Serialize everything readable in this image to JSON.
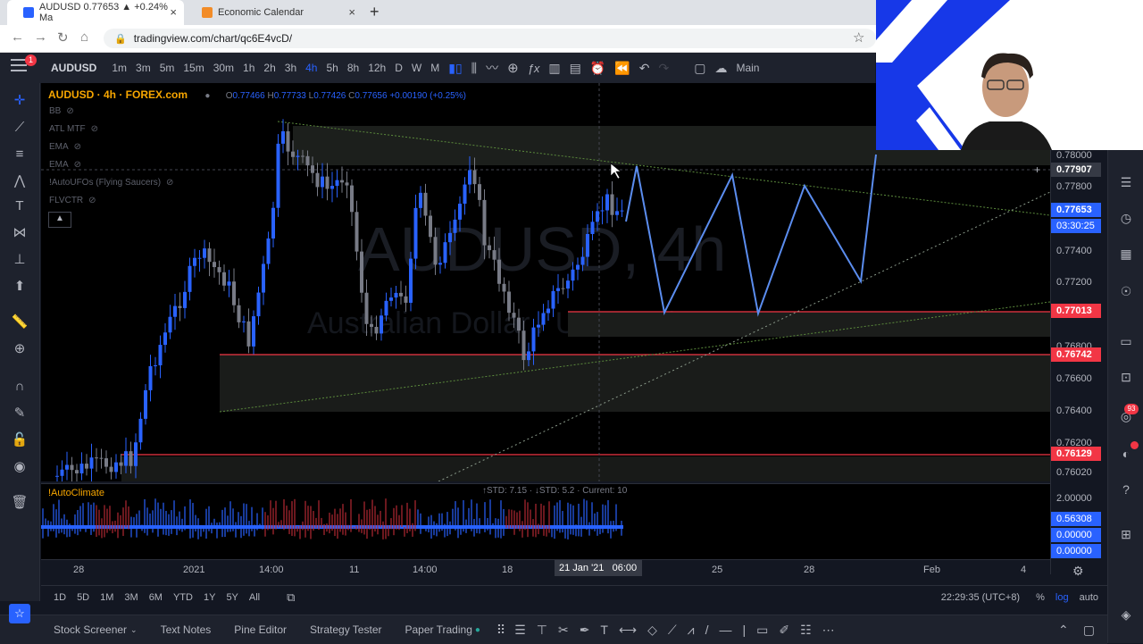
{
  "browser": {
    "tabs": [
      {
        "label": "AUDUSD 0.77653 ▲ +0.24% Ma",
        "active": true
      },
      {
        "label": "Economic Calendar",
        "active": false
      }
    ],
    "url": "tradingview.com/chart/qc6E4vcD/"
  },
  "toolbar": {
    "symbol": "AUDUSD",
    "intervals": [
      "1m",
      "3m",
      "5m",
      "15m",
      "30m",
      "1h",
      "2h",
      "3h",
      "4h",
      "5h",
      "8h",
      "12h",
      "D",
      "W",
      "M"
    ],
    "selected_interval": "4h",
    "layout_label": "Main",
    "menu_badge": "1"
  },
  "legend": {
    "title": "AUDUSD · 4h · FOREX.com",
    "o_label": "O",
    "o_value": "0.77466",
    "h_label": "H",
    "h_value": "0.77733",
    "l_label": "L",
    "l_value": "0.77426",
    "c_label": "C",
    "c_value": "0.77656",
    "change": "+0.00190 (+0.25%)"
  },
  "indicators": [
    "BB",
    "ATL MTF",
    "EMA",
    "EMA",
    "!AutoUFOs (Flying Saucers)",
    "FLVCTR"
  ],
  "watermark": {
    "symbol": "AUDUSD, 4h",
    "name": "Australian Dollar / U.S. Dollar"
  },
  "price_axis": {
    "labels": [
      "0.78000",
      "0.77800",
      "0.77400",
      "0.77200",
      "0.76800",
      "0.76600",
      "0.76400",
      "0.76200",
      "0.76020"
    ],
    "tags": {
      "crosshair": "0.77907",
      "current": "0.77653",
      "countdown": "03:30:25",
      "level1": "0.77013",
      "level2": "0.76742",
      "level3": "0.76129"
    },
    "indicator_labels": [
      "2.00000",
      "0.56308",
      "0.00000",
      "0.00000"
    ]
  },
  "indicator_pane": {
    "name": "!AutoClimate",
    "stats": "↑STD: 7.15 · ↓STD: 5.2 · Current: 10"
  },
  "time_axis": {
    "labels": [
      "28",
      "2021",
      "14:00",
      "11",
      "14:00",
      "18",
      "25",
      "28",
      "Feb",
      "4"
    ],
    "crosshair_date": "21 Jan '21",
    "crosshair_time": "06:00"
  },
  "range_bar": {
    "ranges": [
      "1D",
      "5D",
      "1M",
      "3M",
      "6M",
      "YTD",
      "1Y",
      "5Y",
      "All"
    ],
    "clock": "22:29:35 (UTC+8)",
    "pct": "%",
    "log": "log",
    "auto": "auto"
  },
  "bottom_bar": {
    "items": [
      "Stock Screener",
      "Text Notes",
      "Pine Editor",
      "Strategy Tester",
      "Paper Trading"
    ]
  },
  "right_bar": {
    "badge_alerts": "93"
  },
  "colors": {
    "bull": "#2962ff",
    "bear": "#787b86",
    "projection": "#5b8def",
    "level": "#f23645",
    "accent": "#f7a600"
  }
}
